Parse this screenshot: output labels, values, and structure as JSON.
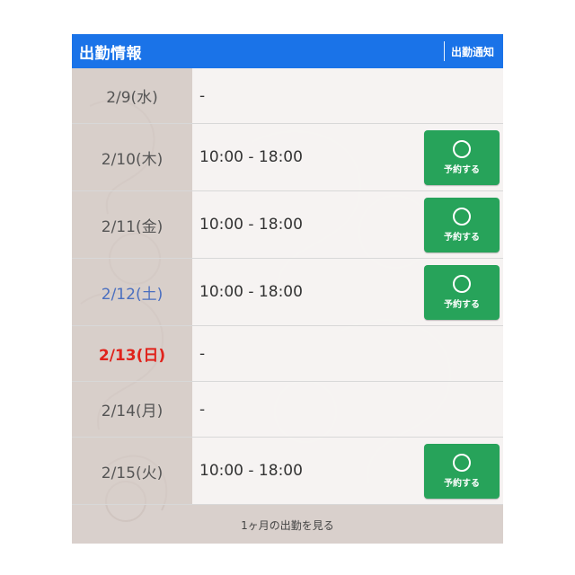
{
  "header": {
    "title": "出勤情報",
    "notice_label": "出勤通知"
  },
  "schedule": [
    {
      "date": "2/9(水)",
      "time": "-",
      "reserve_label": ""
    },
    {
      "date": "2/10(木)",
      "time": "10:00 - 18:00",
      "reserve_label": "予約する"
    },
    {
      "date": "2/11(金)",
      "time": "10:00 - 18:00",
      "reserve_label": "予約する"
    },
    {
      "date": "2/12(土)",
      "time": "10:00 - 18:00",
      "reserve_label": "予約する"
    },
    {
      "date": "2/13(日)",
      "time": "-",
      "reserve_label": ""
    },
    {
      "date": "2/14(月)",
      "time": "-",
      "reserve_label": ""
    },
    {
      "date": "2/15(火)",
      "time": "10:00 - 18:00",
      "reserve_label": "予約する"
    }
  ],
  "footer": {
    "link_label": "1ヶ月の出勤を見る"
  },
  "colors": {
    "header": "#1a73e8",
    "reserve_button": "#27a35a",
    "saturday": "#4a6fc0",
    "sunday": "#e0231c"
  },
  "icons": {
    "reserve": "circle-icon"
  }
}
